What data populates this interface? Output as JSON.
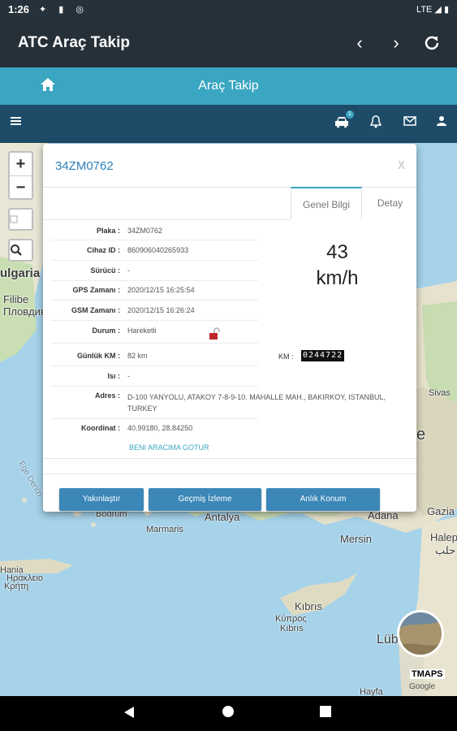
{
  "status_bar": {
    "time": "1:26",
    "network": "LTE"
  },
  "app_bar": {
    "title": "ATC Araç Takip",
    "back_icon": "chevron-left-icon",
    "forward_icon": "chevron-right-icon",
    "refresh_icon": "refresh-icon"
  },
  "header": {
    "title": "Araç Takip",
    "home_icon": "home-icon"
  },
  "toolbar": {
    "menu_icon": "menu-icon",
    "vehicle_icon": "car-icon",
    "vehicle_badge": "1",
    "bell_icon": "bell-icon",
    "mail_icon": "mail-icon",
    "user_icon": "user-icon"
  },
  "map": {
    "zoom_in": "+",
    "zoom_out": "−",
    "labels": {
      "bulgaria": "ulgaria",
      "filibe": "Filibe",
      "plovdiv": "Пловдив",
      "sivas": "Sivas",
      "antalya": "Antalya",
      "marmaris": "Marmaris",
      "bodrum": "Bodrum",
      "adana": "Adana",
      "mersin": "Mersin",
      "gazia": "Gazia",
      "halep": "Halep",
      "halep_ar": "حلب",
      "kibris": "Kıbrıs",
      "kibris_gr": "Κύπρος",
      "kibris_tr": "Kıbrıs",
      "irakleio": "Ηράκλειο",
      "kriti": "Κρήτη",
      "hania": "Hania",
      "lub": "Lüb",
      "hayfa": "Hayfa",
      "ege": "Ege Denizi",
      "e_char": "e"
    },
    "provider": "TMAPS",
    "attribution": "Google"
  },
  "dialog": {
    "title": "34ZM0762",
    "close": "x",
    "tabs": [
      "Genel Bilgi",
      "Detay"
    ],
    "fields": [
      {
        "label": "Plaka :",
        "value": "34ZM0762"
      },
      {
        "label": "Cihaz ID :",
        "value": "860906040265933"
      },
      {
        "label": "Sürücü :",
        "value": "-"
      },
      {
        "label": "GPS Zamanı :",
        "value": "2020/12/15 16:25:54"
      },
      {
        "label": "GSM Zamanı :",
        "value": "2020/12/15 16:26:24"
      },
      {
        "label": "Durum :",
        "value": "Hareketli"
      },
      {
        "label": "Günlük KM :",
        "value": "82 km"
      },
      {
        "label": "Isı :",
        "value": "-"
      },
      {
        "label": "Adres :",
        "value": "D-100 YANYOLU, ATAKOY 7-8-9-10. MAHALLE MAH., BAKIRKOY, ISTANBUL, TURKEY"
      },
      {
        "label": "Koordinat :",
        "value": "40.99180, 28.84250"
      }
    ],
    "speed_value": "43",
    "speed_unit": "km/h",
    "km_label": "KM :",
    "odometer": "0244722",
    "link": "BENI ARACIMA GOTUR",
    "buttons": [
      "Yakınlaştır",
      "Geçmiş İzleme",
      "Anlık Konum"
    ]
  }
}
